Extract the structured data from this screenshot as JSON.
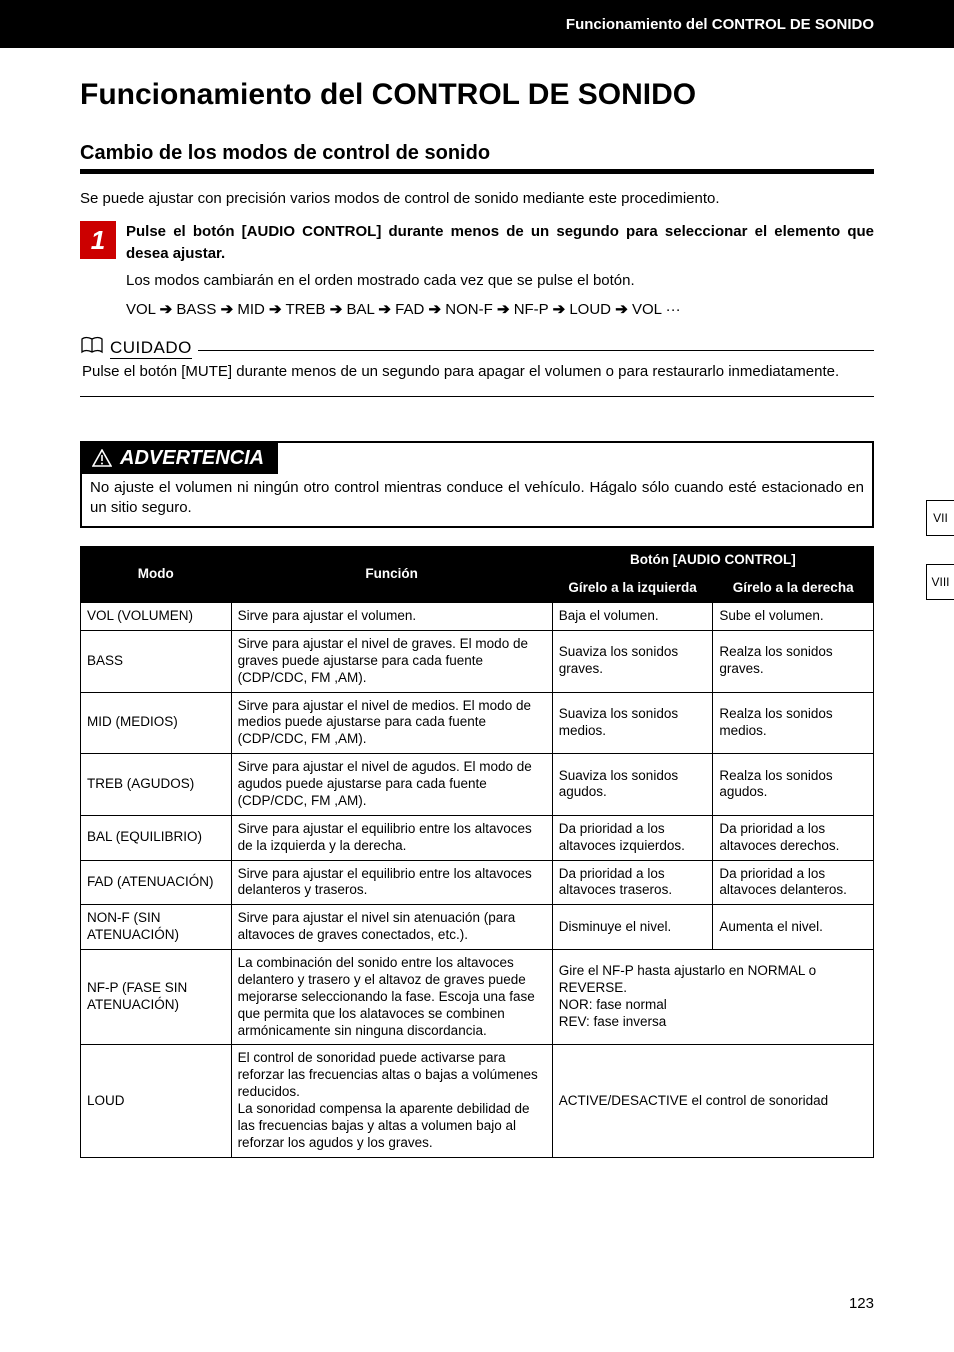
{
  "header": {
    "section_title": "Funcionamiento del CONTROL DE SONIDO"
  },
  "title": "Funcionamiento del CONTROL DE SONIDO",
  "subtitle": "Cambio de los modos de control de sonido",
  "intro": "Se puede ajustar con precisión varios modos de control de sonido mediante este procedimiento.",
  "step": {
    "num": "1",
    "bold": "Pulse el botón [AUDIO CONTROL] durante menos de un segundo para seleccionar el elemento que desea ajustar.",
    "body": "Los modos cambiarán en el orden mostrado cada vez que se pulse el botón.",
    "flow_items": [
      "VOL",
      "BASS",
      "MID",
      "TREB",
      "BAL",
      "FAD",
      "NON-F",
      "NF-P",
      "LOUD",
      "VOL"
    ],
    "flow_trail": "···"
  },
  "cuidado": {
    "label": "CUIDADO",
    "text": "Pulse el botón [MUTE] durante menos de un segundo para apagar el volumen o para restaurarlo inmediatamente."
  },
  "warning": {
    "label": "ADVERTENCIA",
    "text": "No ajuste el volumen ni ningún otro control mientras conduce el vehículo. Hágalo sólo cuando esté estacionado en un sitio seguro."
  },
  "table": {
    "head": {
      "mode": "Modo",
      "function": "Función",
      "button_group": "Botón [AUDIO CONTROL]",
      "turn_left": "Gírelo a la izquierda",
      "turn_right": "Gírelo a la derecha"
    },
    "rows": [
      {
        "mode": "VOL (VOLUMEN)",
        "func": "Sirve para ajustar el volumen.",
        "left": "Baja el volumen.",
        "right": "Sube el volumen."
      },
      {
        "mode": "BASS",
        "func": "Sirve para ajustar el nivel de graves. El modo de graves puede ajustarse para cada fuente (CDP/CDC, FM ,AM).",
        "left": "Suaviza los sonidos graves.",
        "right": "Realza los sonidos graves."
      },
      {
        "mode": "MID (MEDIOS)",
        "func": "Sirve para ajustar el nivel de medios. El modo de medios puede ajustarse para cada fuente (CDP/CDC, FM ,AM).",
        "left": "Suaviza los sonidos medios.",
        "right": "Realza los sonidos medios."
      },
      {
        "mode": "TREB (AGUDOS)",
        "func": "Sirve para ajustar el nivel de agudos. El modo de agudos puede ajustarse para cada fuente (CDP/CDC, FM ,AM).",
        "left": "Suaviza los sonidos agudos.",
        "right": "Realza los sonidos agudos."
      },
      {
        "mode": "BAL (EQUILIBRIO)",
        "func": "Sirve para ajustar el equilibrio entre los altavoces de la izquierda y la derecha.",
        "left": "Da prioridad a los altavoces izquierdos.",
        "right": "Da prioridad a los altavoces derechos."
      },
      {
        "mode": "FAD (ATENUACIÓN)",
        "func": "Sirve para ajustar el equilibrio entre los altavoces delanteros y traseros.",
        "left": "Da prioridad a los altavoces traseros.",
        "right": "Da prioridad a los altavoces delanteros."
      },
      {
        "mode": "NON-F (SIN ATENUACIÓN)",
        "func": "Sirve para ajustar el nivel sin atenuación (para altavoces de graves conectados, etc.).",
        "left": "Disminuye el nivel.",
        "right": "Aumenta el nivel."
      },
      {
        "mode": "NF-P (FASE SIN ATENUACIÓN)",
        "func": "La combinación del sonido entre los altavoces delantero y trasero y el altavoz de graves puede mejorarse seleccionando la fase. Escoja una fase que permita que los alatavoces se combinen armónicamente sin ninguna discordancia.",
        "merged": "Gire el NF-P hasta ajustarlo en NORMAL o REVERSE.\nNOR: fase normal\nREV: fase inversa"
      },
      {
        "mode": "LOUD",
        "func": "El control de sonoridad puede activarse para reforzar las frecuencias altas o bajas a volúmenes reducidos.\nLa sonoridad compensa la aparente debilidad de las frecuencias bajas y altas a volumen bajo al reforzar los agudos y los graves.",
        "merged": "ACTIVE/DESACTIVE el control de sonoridad"
      }
    ]
  },
  "tabs": [
    "VII",
    "VIII"
  ],
  "page_number": "123"
}
